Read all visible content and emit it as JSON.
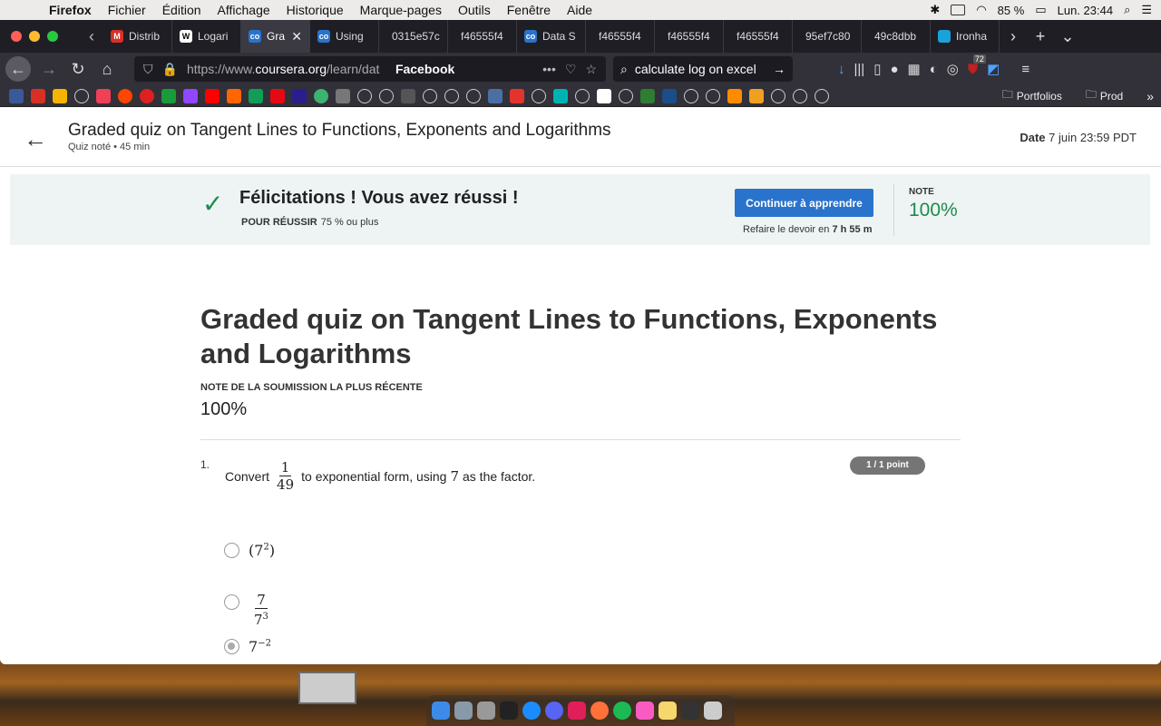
{
  "menubar": {
    "app": "Firefox",
    "items": [
      "Fichier",
      "Édition",
      "Affichage",
      "Historique",
      "Marque-pages",
      "Outils",
      "Fenêtre",
      "Aide"
    ],
    "battery": "85 %",
    "clock": "Lun. 23:44"
  },
  "tabs": [
    {
      "label": "Distrib",
      "color": "#d93025",
      "glyph": "M"
    },
    {
      "label": "Logari",
      "color": "#ffffff",
      "glyph": "W"
    },
    {
      "label": "Gra",
      "color": "#2a73cc",
      "glyph": "co",
      "active": true
    },
    {
      "label": "Using",
      "color": "#2a73cc",
      "glyph": "co"
    },
    {
      "label": "0315e57c",
      "color": "",
      "glyph": ""
    },
    {
      "label": "f46555f4",
      "color": "",
      "glyph": ""
    },
    {
      "label": "Data S",
      "color": "#2a73cc",
      "glyph": "co"
    },
    {
      "label": "f46555f4",
      "color": "",
      "glyph": ""
    },
    {
      "label": "f46555f4",
      "color": "",
      "glyph": ""
    },
    {
      "label": "f46555f4",
      "color": "",
      "glyph": ""
    },
    {
      "label": "95ef7c80",
      "color": "",
      "glyph": ""
    },
    {
      "label": "49c8dbb",
      "color": "",
      "glyph": ""
    },
    {
      "label": "Ironha",
      "color": "#1aa3d9",
      "glyph": ""
    }
  ],
  "navbar": {
    "url_prefix": "https://www.",
    "url_domain": "coursera.org",
    "url_rest": "/learn/dat",
    "site_label": "Facebook",
    "search_value": "calculate log on excel",
    "badge_count": "72"
  },
  "bookmarks": {
    "folders": [
      "Portfolios",
      "Prod"
    ]
  },
  "header": {
    "title": "Graded quiz on Tangent Lines to Functions, Exponents and Logarithms",
    "subtitle": "Quiz noté • 45  min",
    "due_label": "Date",
    "due_value": "7 juin 23:59 PDT"
  },
  "banner": {
    "message": "Félicitations ! Vous avez réussi !",
    "pass_label": "POUR RÉUSSIR",
    "pass_value": "75 % ou plus",
    "button_label": "Continuer à apprendre",
    "retake_text": "Refaire le devoir en",
    "retake_time": "7 h 55 m",
    "grade_label": "NOTE",
    "grade_value": "100%"
  },
  "main": {
    "title": "Graded quiz on Tangent Lines to Functions, Exponents and Logarithms",
    "recent_label": "NOTE DE LA SOUMISSION LA PLUS RÉCENTE",
    "recent_value": "100%"
  },
  "question1": {
    "number": "1.",
    "prefix": "Convert",
    "frac_num": "1",
    "frac_den": "49",
    "suffix": "to exponential form, using",
    "factor": "7",
    "suffix2": "as the factor.",
    "points": "1 / 1 point",
    "options": [
      {
        "base": "7",
        "exp": "2",
        "paren": true
      },
      {
        "num": "7",
        "den_base": "7",
        "den_exp": "3"
      },
      {
        "base": "7",
        "exp": "−2",
        "selected": true
      }
    ]
  }
}
